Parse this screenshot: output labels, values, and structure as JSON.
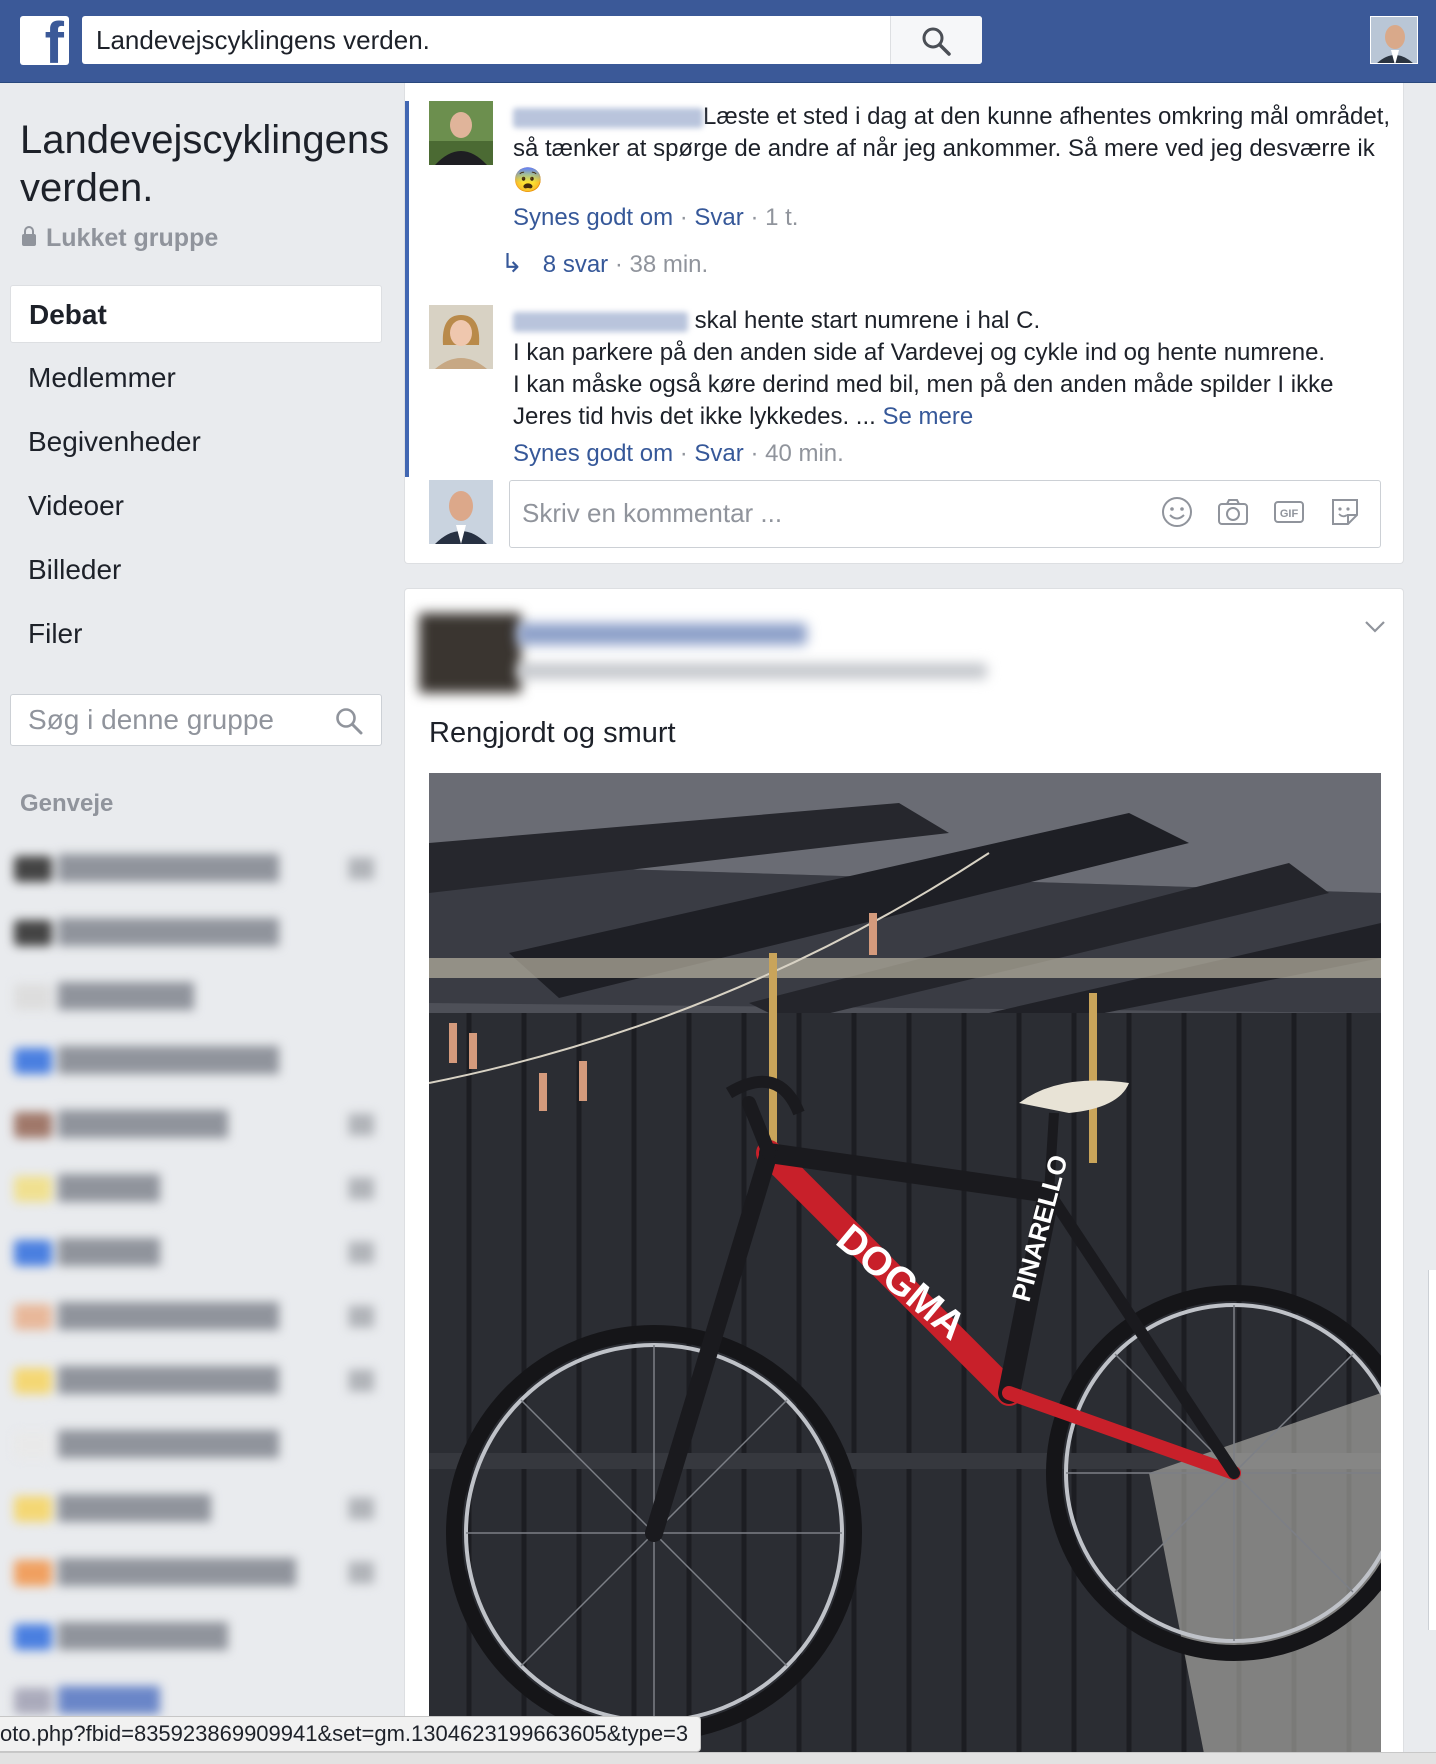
{
  "topbar": {
    "logo": "f",
    "search_value": "Landevejscyklingens verden."
  },
  "sidebar": {
    "group_title": "Landevejscyklingens verden.",
    "group_type": "Lukket gruppe",
    "nav": [
      {
        "label": "Debat",
        "active": true
      },
      {
        "label": "Medlemmer"
      },
      {
        "label": "Begivenheder"
      },
      {
        "label": "Videoer"
      },
      {
        "label": "Billeder"
      },
      {
        "label": "Filer"
      }
    ],
    "search_placeholder": "Søg i denne gruppe",
    "shortcuts_heading": "Genveje"
  },
  "comments": [
    {
      "text": "Læste et sted i dag at den kunne afhentes omkring mål området, så tænker at spørge de andre af når jeg ankommer. Så mere ved jeg desværre ik",
      "emoji": "😨",
      "like": "Synes godt om",
      "reply": "Svar",
      "time": "1 t."
    },
    {
      "line1": " skal hente start numrene i hal C.",
      "line2": "I kan parkere på den anden side af Vardevej og cykle ind og hente numrene.",
      "line3": "I kan måske også køre derind med bil, men på den anden måde spilder I ikke Jeres tid hvis det ikke lykkedes. ...",
      "see_more": "Se mere",
      "like": "Synes godt om",
      "reply": "Svar",
      "time": "40 min."
    }
  ],
  "replies": {
    "label": "8 svar",
    "time": "38 min."
  },
  "composer": {
    "placeholder": "Skriv en kommentar ...",
    "icons": [
      "smiley-icon",
      "camera-icon",
      "gif-icon",
      "sticker-icon"
    ],
    "gif_label": "GIF"
  },
  "post": {
    "text": "Rengjordt og smurt",
    "image_alt": "Red and black road bike hanging in a shed"
  },
  "status_url": "oto.php?fbid=835923869909941&set=gm.1304623199663605&type=3",
  "colors": {
    "brand": "#3b5998",
    "link": "#365899",
    "muted": "#90949c",
    "background": "#e9ebee"
  }
}
